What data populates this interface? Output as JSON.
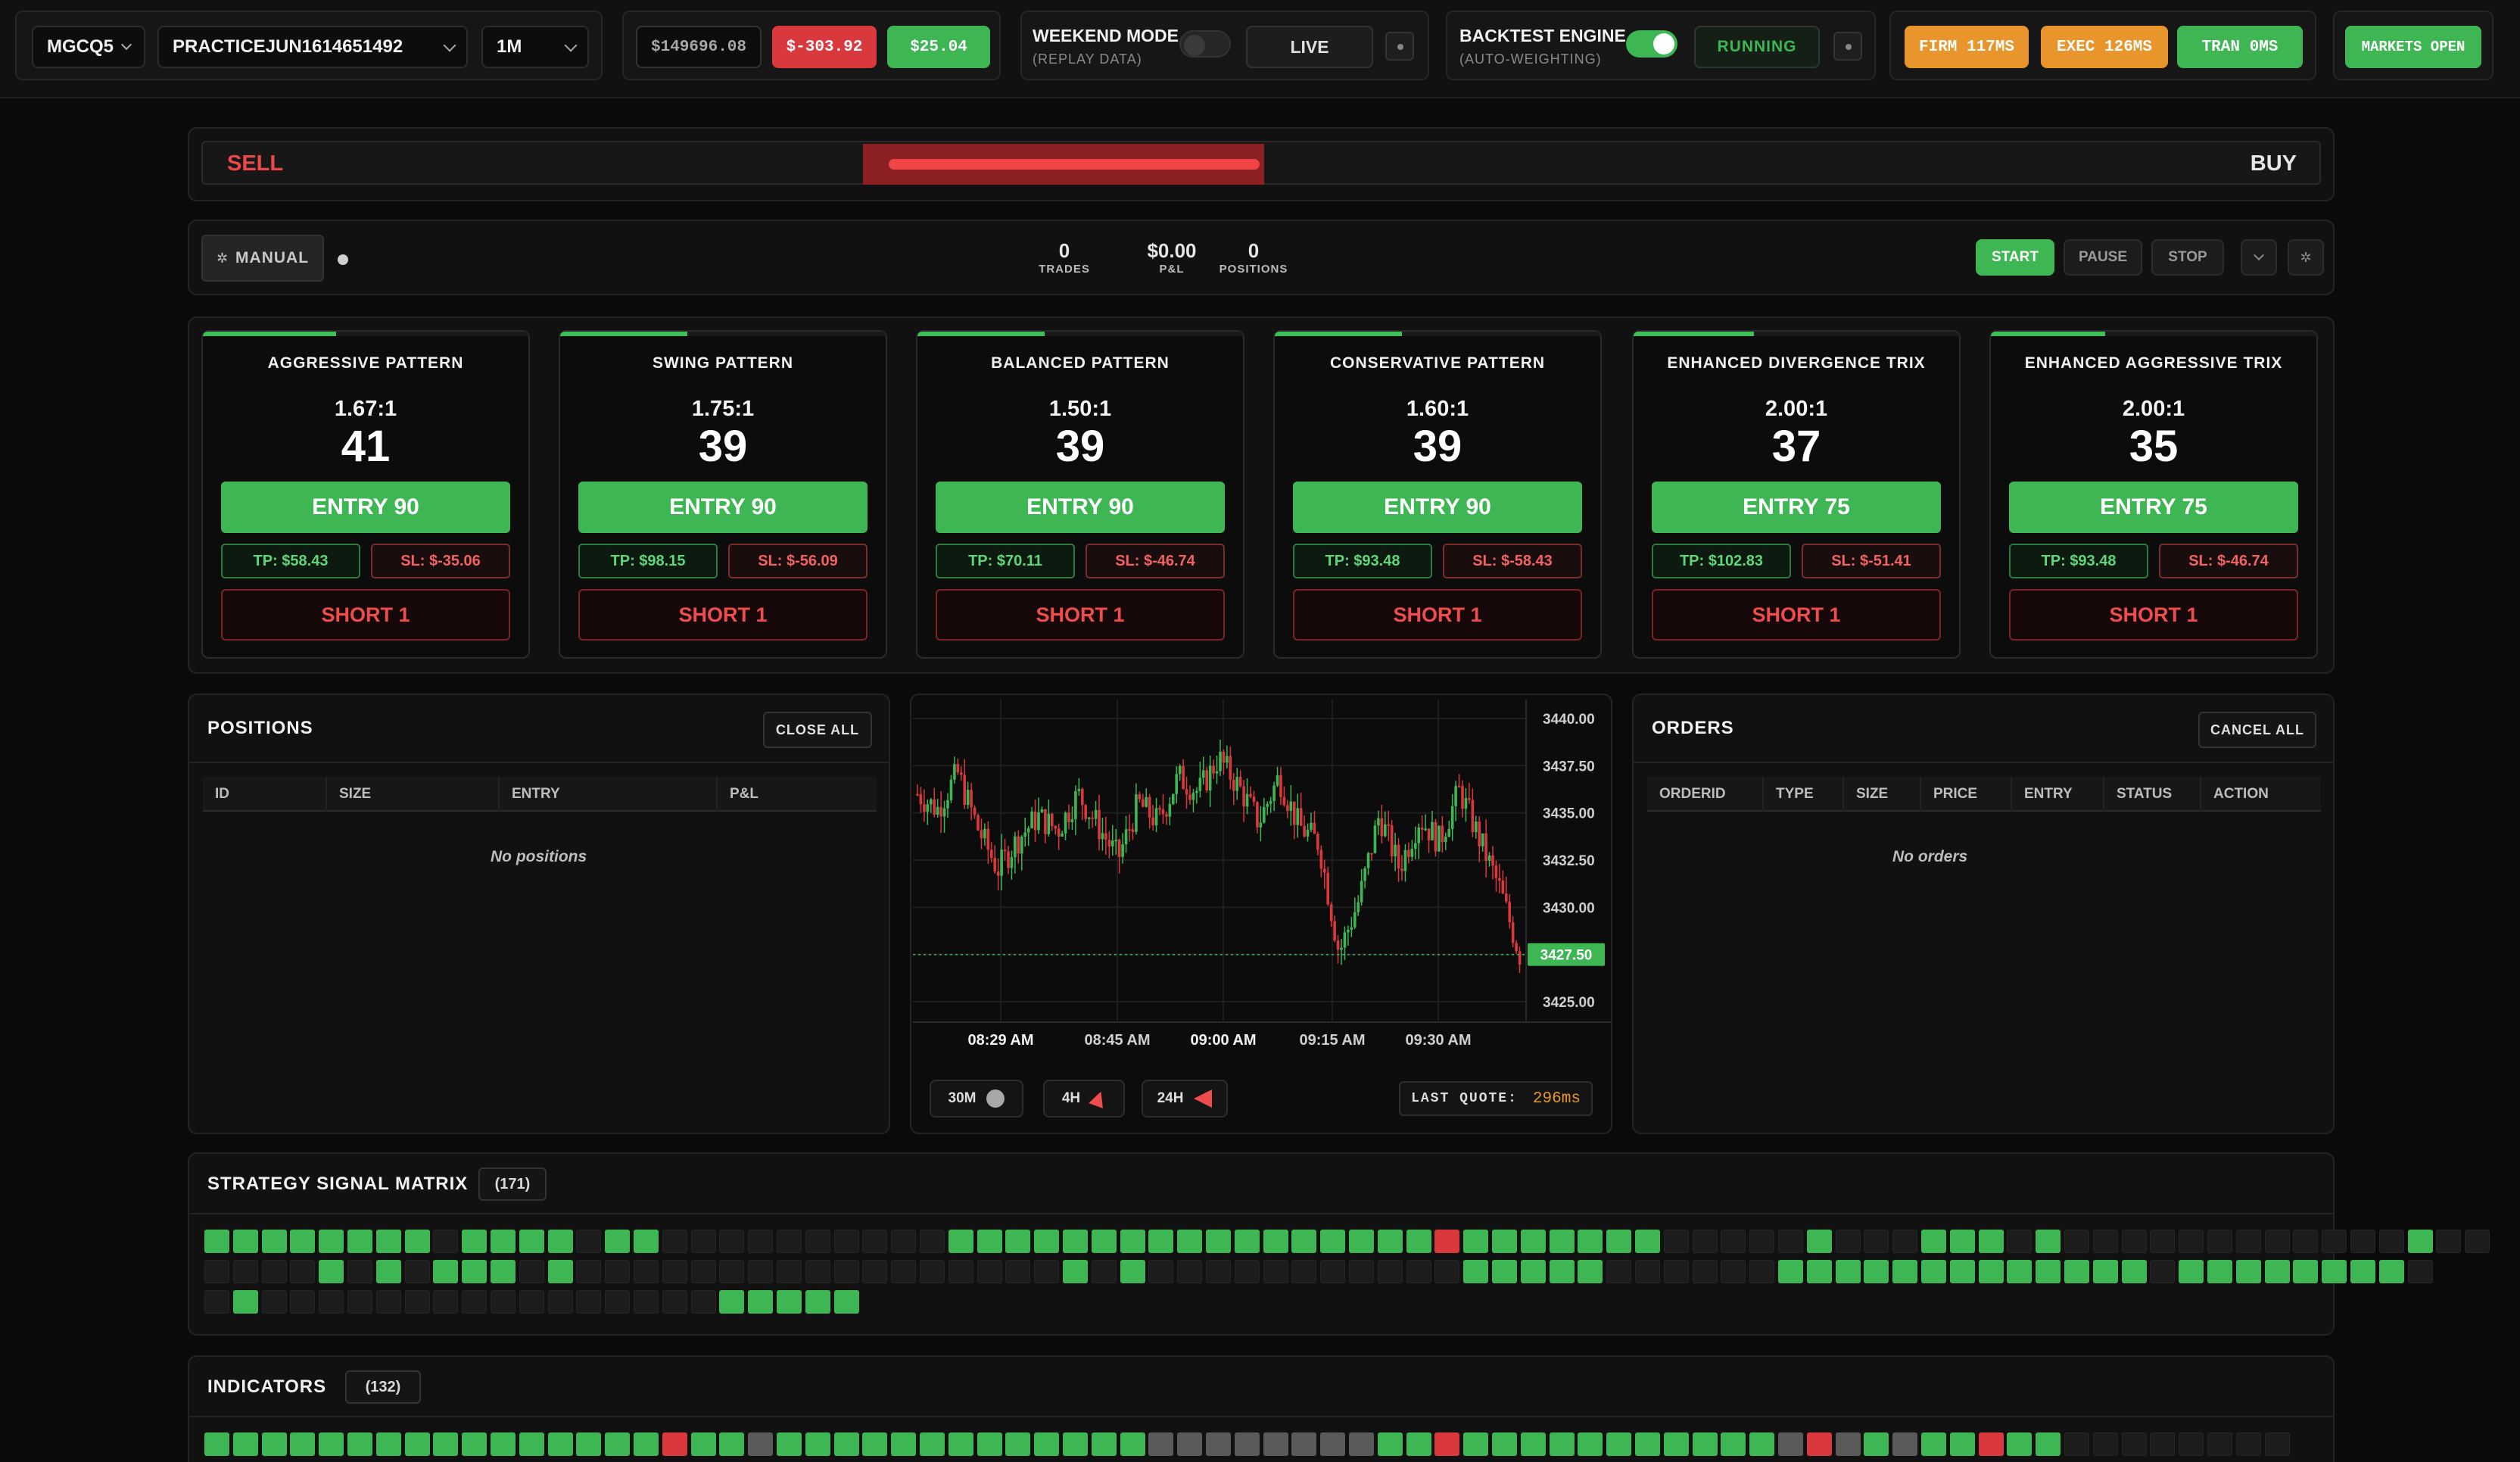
{
  "topbar": {
    "symbol": "MGCQ5",
    "account": "PRACTICEJUN1614651492",
    "timeframe": "1M",
    "balance": "$149696.08",
    "loss": "$-303.92",
    "gain": "$25.04",
    "weekend_mode": {
      "title": "WEEKEND MODE",
      "sub": "(REPLAY DATA)",
      "on": false,
      "live_label": "LIVE"
    },
    "backtest": {
      "title": "BACKTEST ENGINE",
      "sub": "(AUTO-WEIGHTING)",
      "on": true,
      "status": "RUNNING"
    },
    "latency": [
      {
        "label": "FIRM 117MS",
        "color": "#e8962b"
      },
      {
        "label": "EXEC 126MS",
        "color": "#e8962b"
      },
      {
        "label": "TRAN 0MS",
        "color": "#3db653"
      }
    ],
    "market": "MARKETS OPEN"
  },
  "sentiment": {
    "sell_label": "SELL",
    "buy_label": "BUY"
  },
  "controls": {
    "mode": "MANUAL",
    "trades_value": "0",
    "trades_label": "TRADES",
    "pnl_value": "$0.00",
    "pnl_label": "P&L",
    "positions_value": "0",
    "positions_label": "POSITIONS",
    "start": "START",
    "pause": "PAUSE",
    "stop": "STOP"
  },
  "cards": [
    {
      "title": "AGGRESSIVE PATTERN",
      "ratio": "1.67:1",
      "score": "41",
      "entry": "ENTRY 90",
      "tp": "TP: $58.43",
      "sl": "SL: $-35.06",
      "short": "SHORT 1",
      "progress": 0.41
    },
    {
      "title": "SWING PATTERN",
      "ratio": "1.75:1",
      "score": "39",
      "entry": "ENTRY 90",
      "tp": "TP: $98.15",
      "sl": "SL: $-56.09",
      "short": "SHORT 1",
      "progress": 0.39
    },
    {
      "title": "BALANCED PATTERN",
      "ratio": "1.50:1",
      "score": "39",
      "entry": "ENTRY 90",
      "tp": "TP: $70.11",
      "sl": "SL: $-46.74",
      "short": "SHORT 1",
      "progress": 0.39
    },
    {
      "title": "CONSERVATIVE PATTERN",
      "ratio": "1.60:1",
      "score": "39",
      "entry": "ENTRY 90",
      "tp": "TP: $93.48",
      "sl": "SL: $-58.43",
      "short": "SHORT 1",
      "progress": 0.39
    },
    {
      "title": "ENHANCED DIVERGENCE TRIX",
      "ratio": "2.00:1",
      "score": "37",
      "entry": "ENTRY 75",
      "tp": "TP: $102.83",
      "sl": "SL: $-51.41",
      "short": "SHORT 1",
      "progress": 0.37
    },
    {
      "title": "ENHANCED AGGRESSIVE TRIX",
      "ratio": "2.00:1",
      "score": "35",
      "entry": "ENTRY 75",
      "tp": "TP: $93.48",
      "sl": "SL: $-46.74",
      "short": "SHORT 1",
      "progress": 0.35
    }
  ],
  "positions": {
    "title": "POSITIONS",
    "close_all": "CLOSE ALL",
    "columns": [
      "ID",
      "SIZE",
      "ENTRY",
      "P&L"
    ],
    "empty": "No positions"
  },
  "orders": {
    "title": "ORDERS",
    "cancel_all": "CANCEL ALL",
    "columns": [
      "ORDERID",
      "TYPE",
      "SIZE",
      "PRICE",
      "ENTRY",
      "STATUS",
      "ACTION"
    ],
    "empty": "No orders"
  },
  "chart": {
    "y_ticks": [
      "3440.00",
      "3437.50",
      "3435.00",
      "3432.50",
      "3430.00",
      "3427.50",
      "3425.00"
    ],
    "x_ticks": [
      "08:29 AM",
      "08:45 AM",
      "09:00 AM",
      "09:15 AM",
      "09:30 AM"
    ],
    "current_price": "3427.50",
    "ranges": [
      "30M",
      "4H",
      "24H"
    ],
    "last_quote_label": "LAST QUOTE:",
    "last_quote_value": "296ms"
  },
  "chart_data": {
    "type": "candlestick",
    "x": [
      "08:29 AM",
      "08:45 AM",
      "09:00 AM",
      "09:15 AM",
      "09:30 AM"
    ],
    "ylim": [
      3424.0,
      3441.0
    ],
    "close": [
      3436.0,
      3435.2,
      3437.1,
      3434.2,
      3432.0,
      3433.6,
      3434.8,
      3434.1,
      3436.0,
      3434.3,
      3432.6,
      3435.5,
      3434.5,
      3436.9,
      3436.1,
      3437.9,
      3436.4,
      3434.5,
      3436.9,
      3434.3,
      3433.4,
      3427.6,
      3430.4,
      3434.9,
      3432.1,
      3434.7,
      3433.5,
      3436.2,
      3433.6,
      3431.0,
      3427.5
    ],
    "current": 3427.5
  },
  "matrix": {
    "title": "STRATEGY SIGNAL MATRIX",
    "count": "(171)",
    "rows": [
      "GGGGGGGGDGGGGDGGDDDDDDDDDDGGGGGGGGGGGGGGGGGRGGGGGGGDDDDDGDDDGGGDGDDDDDDDDDDDDGDD",
      "DDDDGDGDGGGDGDDDDDDDDDDDDDDDDDGDGDDDDDDDDDDDGGGGGDDDDDDGGGGGGGGGGGGGDGGGGGGGGD",
      "DGDDDDDDDDDDDDDDDDGGGGG"
    ]
  },
  "indicators": {
    "title": "INDICATORS",
    "count": "(132)",
    "row": "GGGGGGGGGGGGGGGGRGGYGGGGGGGGGGGGGYYYYYYYYGGRGGGGGGGGGGGYRYGYGGRGGDDDDDDDD"
  }
}
